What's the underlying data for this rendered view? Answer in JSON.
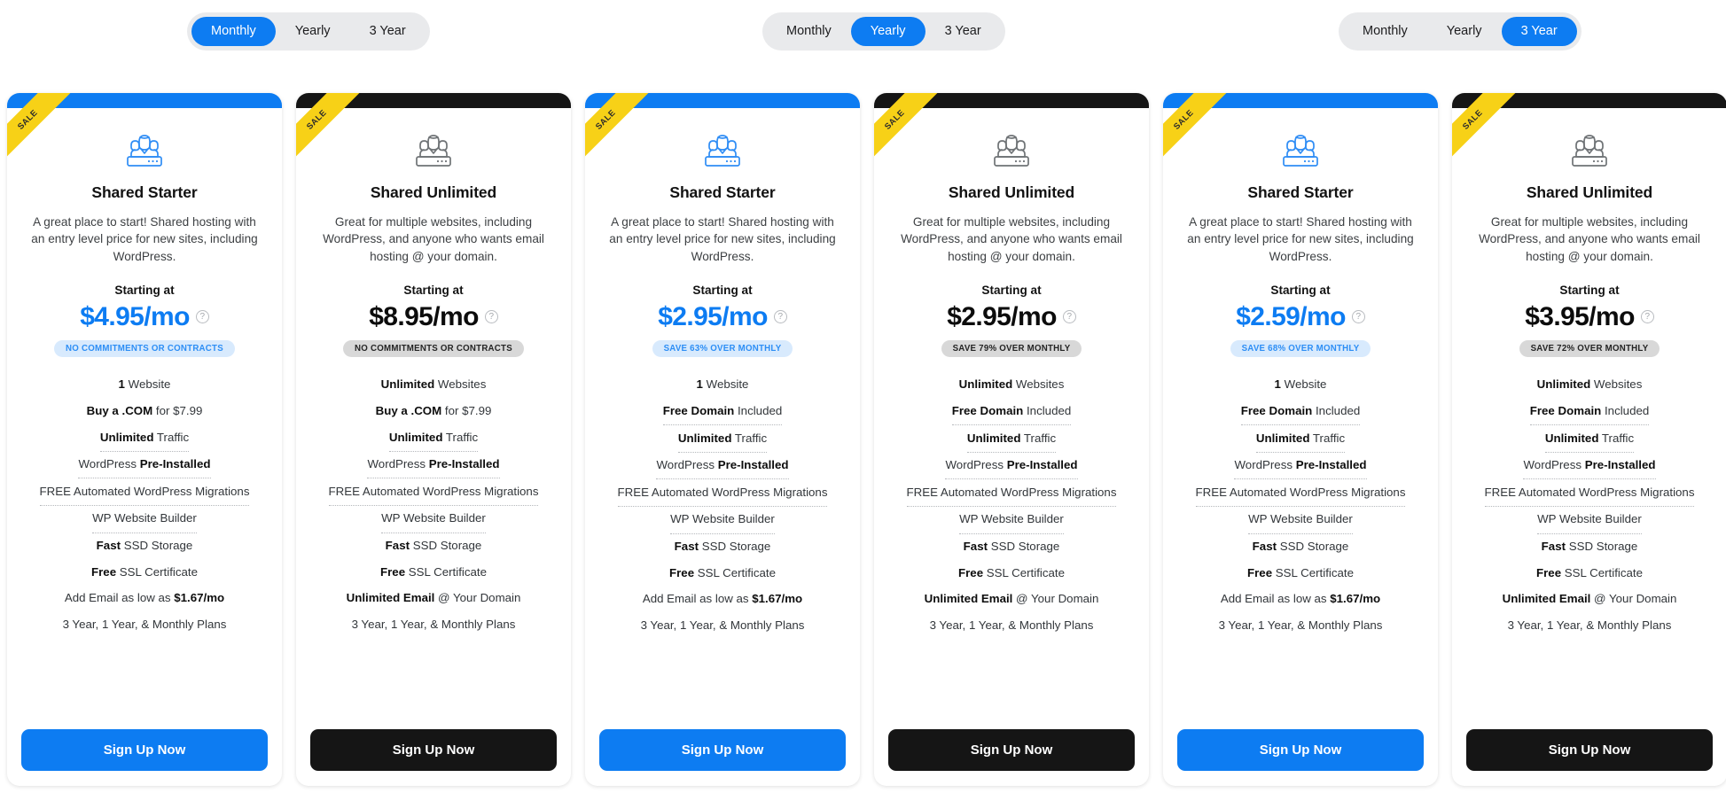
{
  "toggles": [
    {
      "name": "monthly-toggle",
      "options": [
        "Monthly",
        "Yearly",
        "3 Year"
      ],
      "active": 0
    },
    {
      "name": "yearly-toggle",
      "options": [
        "Monthly",
        "Yearly",
        "3 Year"
      ],
      "active": 1
    },
    {
      "name": "three-year-toggle",
      "options": [
        "Monthly",
        "Yearly",
        "3 Year"
      ],
      "active": 2
    }
  ],
  "colors": {
    "accent_blue": "#0d7cf2",
    "accent_dark": "#151515",
    "ribbon_yellow": "#f7d117",
    "badge_blue_bg": "#d8eafd",
    "badge_dark_bg": "#d8d8d8",
    "toggle_track": "#e9eaec"
  },
  "ribbon_label": "SALE",
  "starting_at_label": "Starting at",
  "signup_label": "Sign Up Now",
  "info_icon_glyph": "?",
  "cards": [
    {
      "theme": "blue",
      "icon": "team-server-icon",
      "title": "Shared Starter",
      "description": "A great place to start! Shared hosting with an entry level price for new sites, including WordPress.",
      "price": "$4.95",
      "price_period": "/mo",
      "badge": "NO COMMITMENTS OR CONTRACTS",
      "features": [
        {
          "strong": "1",
          "rest": " Website",
          "tooltip": false
        },
        {
          "strong": "Buy a .COM",
          "rest": " for $7.99",
          "tooltip": false
        },
        {
          "strong": "Unlimited",
          "rest": " Traffic",
          "tooltip": true
        },
        {
          "strong": "",
          "rest": "WordPress ",
          "strong_after": "Pre-Installed",
          "tooltip": true
        },
        {
          "strong": "",
          "rest": "FREE Automated WordPress Migrations",
          "tooltip": true
        },
        {
          "strong": "",
          "rest": "WP Website Builder",
          "tooltip": true
        },
        {
          "strong": "Fast",
          "rest": " SSD Storage",
          "tooltip": false
        },
        {
          "strong": "Free",
          "rest": " SSL Certificate",
          "tooltip": false
        },
        {
          "strong": "",
          "rest": "Add Email as low as ",
          "strong_after": "$1.67/mo",
          "tooltip": false
        },
        {
          "strong": "",
          "rest": "3 Year, 1 Year, & Monthly Plans",
          "tooltip": false
        }
      ]
    },
    {
      "theme": "dark",
      "icon": "team-server-icon",
      "title": "Shared Unlimited",
      "description": "Great for multiple websites, including WordPress, and anyone who wants email hosting @ your domain.",
      "price": "$8.95",
      "price_period": "/mo",
      "badge": "NO COMMITMENTS OR CONTRACTS",
      "features": [
        {
          "strong": "Unlimited",
          "rest": " Websites",
          "tooltip": false
        },
        {
          "strong": "Buy a .COM",
          "rest": " for $7.99",
          "tooltip": false
        },
        {
          "strong": "Unlimited",
          "rest": " Traffic",
          "tooltip": true
        },
        {
          "strong": "",
          "rest": "WordPress ",
          "strong_after": "Pre-Installed",
          "tooltip": true
        },
        {
          "strong": "",
          "rest": "FREE Automated WordPress Migrations",
          "tooltip": true
        },
        {
          "strong": "",
          "rest": "WP Website Builder",
          "tooltip": true
        },
        {
          "strong": "Fast",
          "rest": " SSD Storage",
          "tooltip": false
        },
        {
          "strong": "Free",
          "rest": " SSL Certificate",
          "tooltip": false
        },
        {
          "strong": "Unlimited Email",
          "rest": " @ Your Domain",
          "tooltip": false
        },
        {
          "strong": "",
          "rest": "3 Year, 1 Year, & Monthly Plans",
          "tooltip": false
        }
      ]
    },
    {
      "theme": "blue",
      "icon": "team-server-icon",
      "title": "Shared Starter",
      "description": "A great place to start! Shared hosting with an entry level price for new sites, including WordPress.",
      "price": "$2.95",
      "price_period": "/mo",
      "badge": "SAVE 63% OVER MONTHLY",
      "features": [
        {
          "strong": "1",
          "rest": " Website",
          "tooltip": false
        },
        {
          "strong": "Free Domain",
          "rest": " Included",
          "tooltip": true
        },
        {
          "strong": "Unlimited",
          "rest": " Traffic",
          "tooltip": true
        },
        {
          "strong": "",
          "rest": "WordPress ",
          "strong_after": "Pre-Installed",
          "tooltip": true
        },
        {
          "strong": "",
          "rest": "FREE Automated WordPress Migrations",
          "tooltip": true
        },
        {
          "strong": "",
          "rest": "WP Website Builder",
          "tooltip": true
        },
        {
          "strong": "Fast",
          "rest": " SSD Storage",
          "tooltip": false
        },
        {
          "strong": "Free",
          "rest": " SSL Certificate",
          "tooltip": false
        },
        {
          "strong": "",
          "rest": "Add Email as low as ",
          "strong_after": "$1.67/mo",
          "tooltip": false
        },
        {
          "strong": "",
          "rest": "3 Year, 1 Year, & Monthly Plans",
          "tooltip": false
        }
      ]
    },
    {
      "theme": "dark",
      "icon": "team-server-icon",
      "title": "Shared Unlimited",
      "description": "Great for multiple websites, including WordPress, and anyone who wants email hosting @ your domain.",
      "price": "$2.95",
      "price_period": "/mo",
      "badge": "SAVE 79% OVER MONTHLY",
      "features": [
        {
          "strong": "Unlimited",
          "rest": " Websites",
          "tooltip": false
        },
        {
          "strong": "Free Domain",
          "rest": " Included",
          "tooltip": true
        },
        {
          "strong": "Unlimited",
          "rest": " Traffic",
          "tooltip": true
        },
        {
          "strong": "",
          "rest": "WordPress ",
          "strong_after": "Pre-Installed",
          "tooltip": true
        },
        {
          "strong": "",
          "rest": "FREE Automated WordPress Migrations",
          "tooltip": true
        },
        {
          "strong": "",
          "rest": "WP Website Builder",
          "tooltip": true
        },
        {
          "strong": "Fast",
          "rest": " SSD Storage",
          "tooltip": false
        },
        {
          "strong": "Free",
          "rest": " SSL Certificate",
          "tooltip": false
        },
        {
          "strong": "Unlimited Email",
          "rest": " @ Your Domain",
          "tooltip": false
        },
        {
          "strong": "",
          "rest": "3 Year, 1 Year, & Monthly Plans",
          "tooltip": false
        }
      ]
    },
    {
      "theme": "blue",
      "icon": "team-server-icon",
      "title": "Shared Starter",
      "description": "A great place to start! Shared hosting with an entry level price for new sites, including WordPress.",
      "price": "$2.59",
      "price_period": "/mo",
      "badge": "SAVE 68% OVER MONTHLY",
      "features": [
        {
          "strong": "1",
          "rest": " Website",
          "tooltip": false
        },
        {
          "strong": "Free Domain",
          "rest": " Included",
          "tooltip": true
        },
        {
          "strong": "Unlimited",
          "rest": " Traffic",
          "tooltip": true
        },
        {
          "strong": "",
          "rest": "WordPress ",
          "strong_after": "Pre-Installed",
          "tooltip": true
        },
        {
          "strong": "",
          "rest": "FREE Automated WordPress Migrations",
          "tooltip": true
        },
        {
          "strong": "",
          "rest": "WP Website Builder",
          "tooltip": true
        },
        {
          "strong": "Fast",
          "rest": " SSD Storage",
          "tooltip": false
        },
        {
          "strong": "Free",
          "rest": " SSL Certificate",
          "tooltip": false
        },
        {
          "strong": "",
          "rest": "Add Email as low as ",
          "strong_after": "$1.67/mo",
          "tooltip": false
        },
        {
          "strong": "",
          "rest": "3 Year, 1 Year, & Monthly Plans",
          "tooltip": false
        }
      ]
    },
    {
      "theme": "dark",
      "icon": "team-server-icon",
      "title": "Shared Unlimited",
      "description": "Great for multiple websites, including WordPress, and anyone who wants email hosting @ your domain.",
      "price": "$3.95",
      "price_period": "/mo",
      "badge": "SAVE 72% OVER MONTHLY",
      "features": [
        {
          "strong": "Unlimited",
          "rest": " Websites",
          "tooltip": false
        },
        {
          "strong": "Free Domain",
          "rest": " Included",
          "tooltip": true
        },
        {
          "strong": "Unlimited",
          "rest": " Traffic",
          "tooltip": true
        },
        {
          "strong": "",
          "rest": "WordPress ",
          "strong_after": "Pre-Installed",
          "tooltip": true
        },
        {
          "strong": "",
          "rest": "FREE Automated WordPress Migrations",
          "tooltip": true
        },
        {
          "strong": "",
          "rest": "WP Website Builder",
          "tooltip": true
        },
        {
          "strong": "Fast",
          "rest": " SSD Storage",
          "tooltip": false
        },
        {
          "strong": "Free",
          "rest": " SSL Certificate",
          "tooltip": false
        },
        {
          "strong": "Unlimited Email",
          "rest": " @ Your Domain",
          "tooltip": false
        },
        {
          "strong": "",
          "rest": "3 Year, 1 Year, & Monthly Plans",
          "tooltip": false
        }
      ]
    }
  ]
}
